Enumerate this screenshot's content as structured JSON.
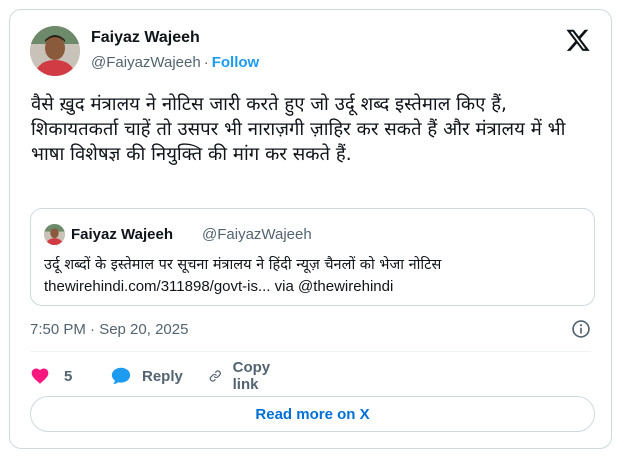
{
  "author": {
    "name": "Faiyaz Wajeeh",
    "handle": "@FaiyazWajeeh",
    "separator": "·",
    "follow_label": "Follow"
  },
  "tweet": {
    "text": "वैसे ख़ुद मंत्रालय ने नोटिस जारी करते हुए जो उर्दू शब्द इस्तेमाल किए हैं, शिकायतकर्ता चाहें तो उसपर भी नाराज़गी ज़ाहिर कर सकते हैं और मंत्रालय में भी भाषा विशेषज्ञ की नियुक्ति की मांग कर सकते हैं."
  },
  "quoted_tweet": {
    "name": "Faiyaz Wajeeh",
    "handle": "@FaiyazWajeeh",
    "text": "उर्दू शब्दों के इस्तेमाल पर सूचना मंत्रालय ने हिंदी न्यूज़ चैनलों को भेजा नोटिस",
    "link": "thewirehindi.com/311898/govt-is... via @thewirehindi"
  },
  "timestamp": "7:50 PM · Sep 20, 2025",
  "actions": {
    "like_count": "5",
    "reply_label": "Reply",
    "copy_link_label": "Copy link"
  },
  "read_more_label": "Read more on X",
  "icons": {
    "logo": "x-logo-icon",
    "info": "info-icon",
    "like": "heart-icon",
    "reply": "speech-bubble-icon",
    "copy_link": "link-icon"
  },
  "colors": {
    "like": "#f91880",
    "reply": "#1d9bf0",
    "link": "#006fd6",
    "follow": "#1d9bf0",
    "secondary_text": "#536471"
  }
}
